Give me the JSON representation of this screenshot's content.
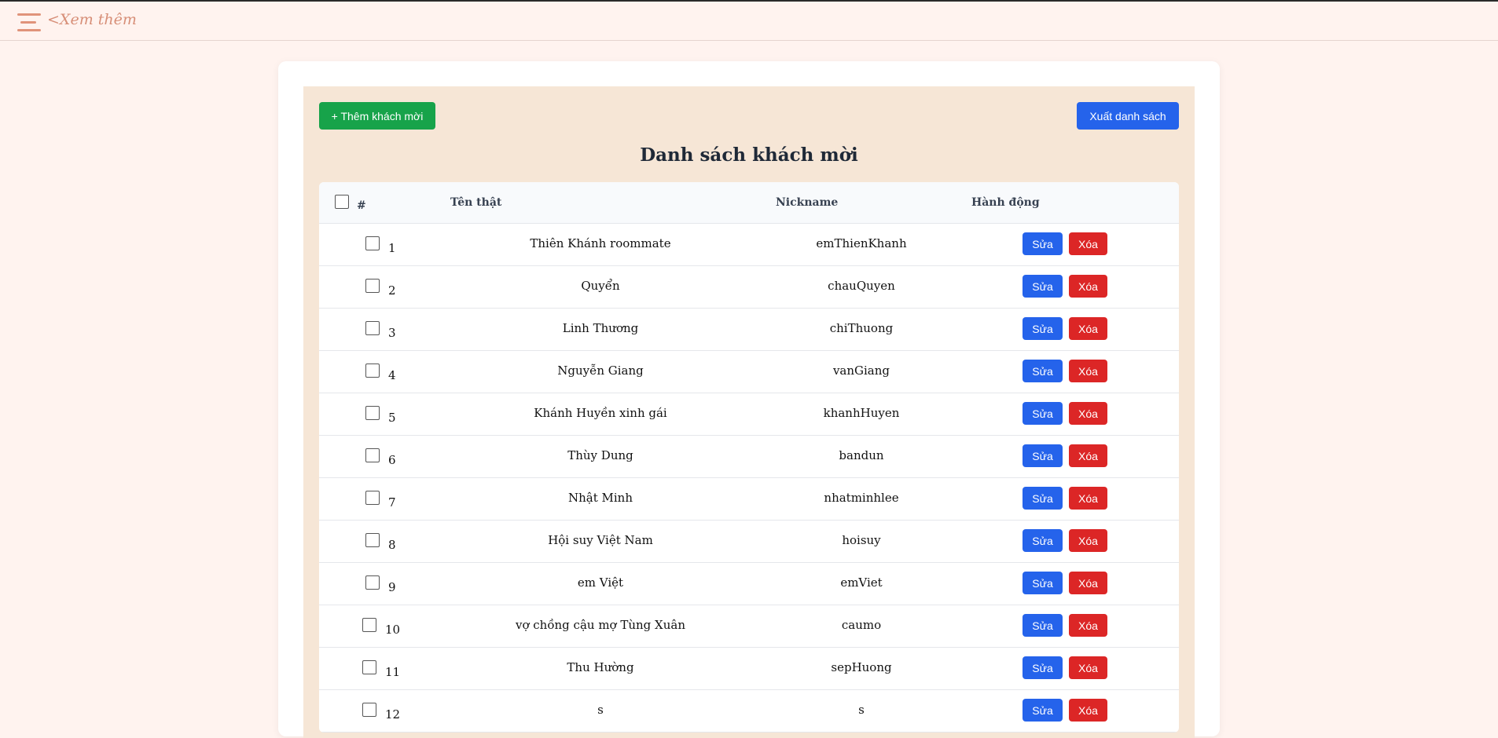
{
  "topbar": {
    "more_label": "<Xem thêm"
  },
  "toolbar": {
    "add_label": "+ Thêm khách mời",
    "export_label": "Xuất danh sách"
  },
  "page_title": "Danh sách khách mời",
  "table": {
    "headers": {
      "index": "#",
      "real_name": "Tên thật",
      "nickname": "Nickname",
      "actions": "Hành động"
    },
    "edit_label": "Sửa",
    "delete_label": "Xóa",
    "rows": [
      {
        "index": "1",
        "real_name": "Thiên Khánh roommate",
        "nickname": "emThienKhanh"
      },
      {
        "index": "2",
        "real_name": "Quyển",
        "nickname": "chauQuyen"
      },
      {
        "index": "3",
        "real_name": "Linh Thương",
        "nickname": "chiThuong"
      },
      {
        "index": "4",
        "real_name": "Nguyễn Giang",
        "nickname": "vanGiang"
      },
      {
        "index": "5",
        "real_name": "Khánh Huyền xinh gái",
        "nickname": "khanhHuyen"
      },
      {
        "index": "6",
        "real_name": "Thùy Dung",
        "nickname": "bandun"
      },
      {
        "index": "7",
        "real_name": "Nhật Minh",
        "nickname": "nhatminhlee"
      },
      {
        "index": "8",
        "real_name": "Hội suy Việt Nam",
        "nickname": "hoisuy"
      },
      {
        "index": "9",
        "real_name": "em Việt",
        "nickname": "emViet"
      },
      {
        "index": "10",
        "real_name": "vợ chồng cậu mợ Tùng Xuân",
        "nickname": "caumo"
      },
      {
        "index": "11",
        "real_name": "Thu Hường",
        "nickname": "sepHuong"
      },
      {
        "index": "12",
        "real_name": "s",
        "nickname": "s"
      }
    ]
  }
}
